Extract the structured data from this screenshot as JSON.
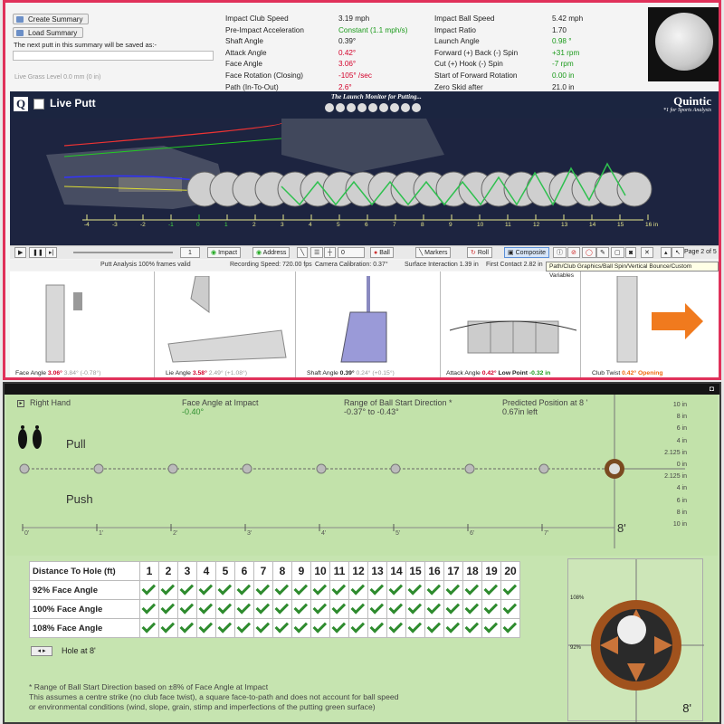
{
  "top": {
    "buttons": {
      "create_summary": "Create Summary",
      "load_summary": "Load Summary"
    },
    "save_note": "The next putt in this summary will be saved as:-",
    "live_grass": "Live Grass Level  0.0 mm   (0 in)",
    "metrics_left": [
      {
        "label": "Impact Club Speed",
        "value": "3.19 mph"
      },
      {
        "label": "Pre-Impact Acceleration",
        "value": "Constant (1.1 mph/s)"
      },
      {
        "label": "Shaft Angle",
        "value": "0.39°"
      },
      {
        "label": "Attack Angle",
        "value": "0.42°"
      },
      {
        "label": "Face Angle",
        "value": "3.06°"
      },
      {
        "label": "Face Rotation (Closing)",
        "value": "-105° /sec"
      },
      {
        "label": "Path (In-To-Out)",
        "value": "2.6°"
      }
    ],
    "metrics_right": [
      {
        "label": "Impact Ball Speed",
        "value": "5.42 mph"
      },
      {
        "label": "Impact Ratio",
        "value": "1.70"
      },
      {
        "label": "Launch Angle",
        "value": "0.98 °"
      },
      {
        "label": "Forward (+) Back (-) Spin",
        "value": "+31 rpm"
      },
      {
        "label": "Cut (+) Hook (-) Spin",
        "value": "-7 rpm"
      },
      {
        "label": "Start of Forward Rotation",
        "value": "0.00 in"
      },
      {
        "label": "Zero Skid after",
        "value": "21.0 in"
      }
    ],
    "live_putt": "Live Putt",
    "brand": "Quintic",
    "brand_sub": "*1 for Sports Analysis",
    "tagline": "The Launch Monitor for Putting...",
    "scale": [
      "-4",
      "-3",
      "-2",
      "-1",
      "0",
      "1",
      "2",
      "3",
      "4",
      "5",
      "6",
      "7",
      "8",
      "9",
      "10",
      "11",
      "12",
      "13",
      "14",
      "15",
      "16 in"
    ],
    "toolbar": {
      "frame": "1",
      "impact": "Impact",
      "address": "Address",
      "stepper": "0",
      "ball": "Ball",
      "markers": "Markers",
      "roll": "Roll",
      "composite": "Composite",
      "page": "Page 2 of 5",
      "tooltip": "Path/Club Graphics/Ball Spin/Vertical Bounce/Custom Variables"
    },
    "status": {
      "valid": "Putt Analysis 100% frames valid",
      "speed": "Recording Speed: 720.00 fps",
      "calibration": "Camera Calibration: 0.37°",
      "surface": "Surface Interaction 1.39 in",
      "contact": "First Contact 2.82 in"
    },
    "panels": [
      {
        "label": "Face Angle",
        "v1": "3.06°",
        "v2": "3.84°",
        "v3": "(-0.78°)"
      },
      {
        "label": "Lie Angle",
        "v1": "3.58°",
        "v2": "2.49°",
        "v3": "(+1.08°)"
      },
      {
        "label": "Shaft Angle",
        "v1": "0.39°",
        "v2": "0.24°",
        "v3": "(+0.15°)"
      },
      {
        "label": "Attack Angle",
        "v1": "0.42°",
        "v2": "Low Point",
        "v3": "-0.32 in"
      },
      {
        "label": "Club Twist",
        "v1": "0.42°",
        "v2": "Opening",
        "v3": ""
      }
    ]
  },
  "bottom": {
    "hand": "Right Hand",
    "face_angle_title": "Face Angle at Impact",
    "face_angle_value": "-0.40°",
    "range_title": "Range of Ball Start Direction *",
    "range_value": "-0.37° to -0.43°",
    "predicted_title": "Predicted Position at 8 '",
    "predicted_value": "0.67in left",
    "pull": "Pull",
    "push": "Push",
    "positions": [
      "10 in",
      "8 in",
      "6 in",
      "4 in",
      "2.125 in",
      "0 in",
      "2.125 in",
      "4 in",
      "6 in",
      "8 in",
      "10 in"
    ],
    "feet": [
      "0'",
      "1'",
      "2'",
      "3'",
      "4'",
      "5'",
      "6'",
      "7'"
    ],
    "eight_ft": "8'",
    "table": {
      "header": "Distance To Hole (ft)",
      "distances": [
        "1",
        "2",
        "3",
        "4",
        "5",
        "6",
        "7",
        "8",
        "9",
        "10",
        "11",
        "12",
        "13",
        "14",
        "15",
        "16",
        "17",
        "18",
        "19",
        "20"
      ],
      "rows": [
        "92% Face Angle",
        "100% Face Angle",
        "108% Face Angle"
      ]
    },
    "hole_at": "Hole at 8'",
    "hole_pct_top": "108%",
    "hole_pct_bottom": "92%",
    "hole_8ft": "8'",
    "footnote1": "* Range of Ball Start Direction based on ±8% of Face Angle at Impact",
    "footnote2": "This assumes a centre strike (no club face twist), a square face-to-path and does not account for ball speed",
    "footnote3": "or environmental conditions (wind, slope, grain, stimp and imperfections of the putting green surface)"
  }
}
